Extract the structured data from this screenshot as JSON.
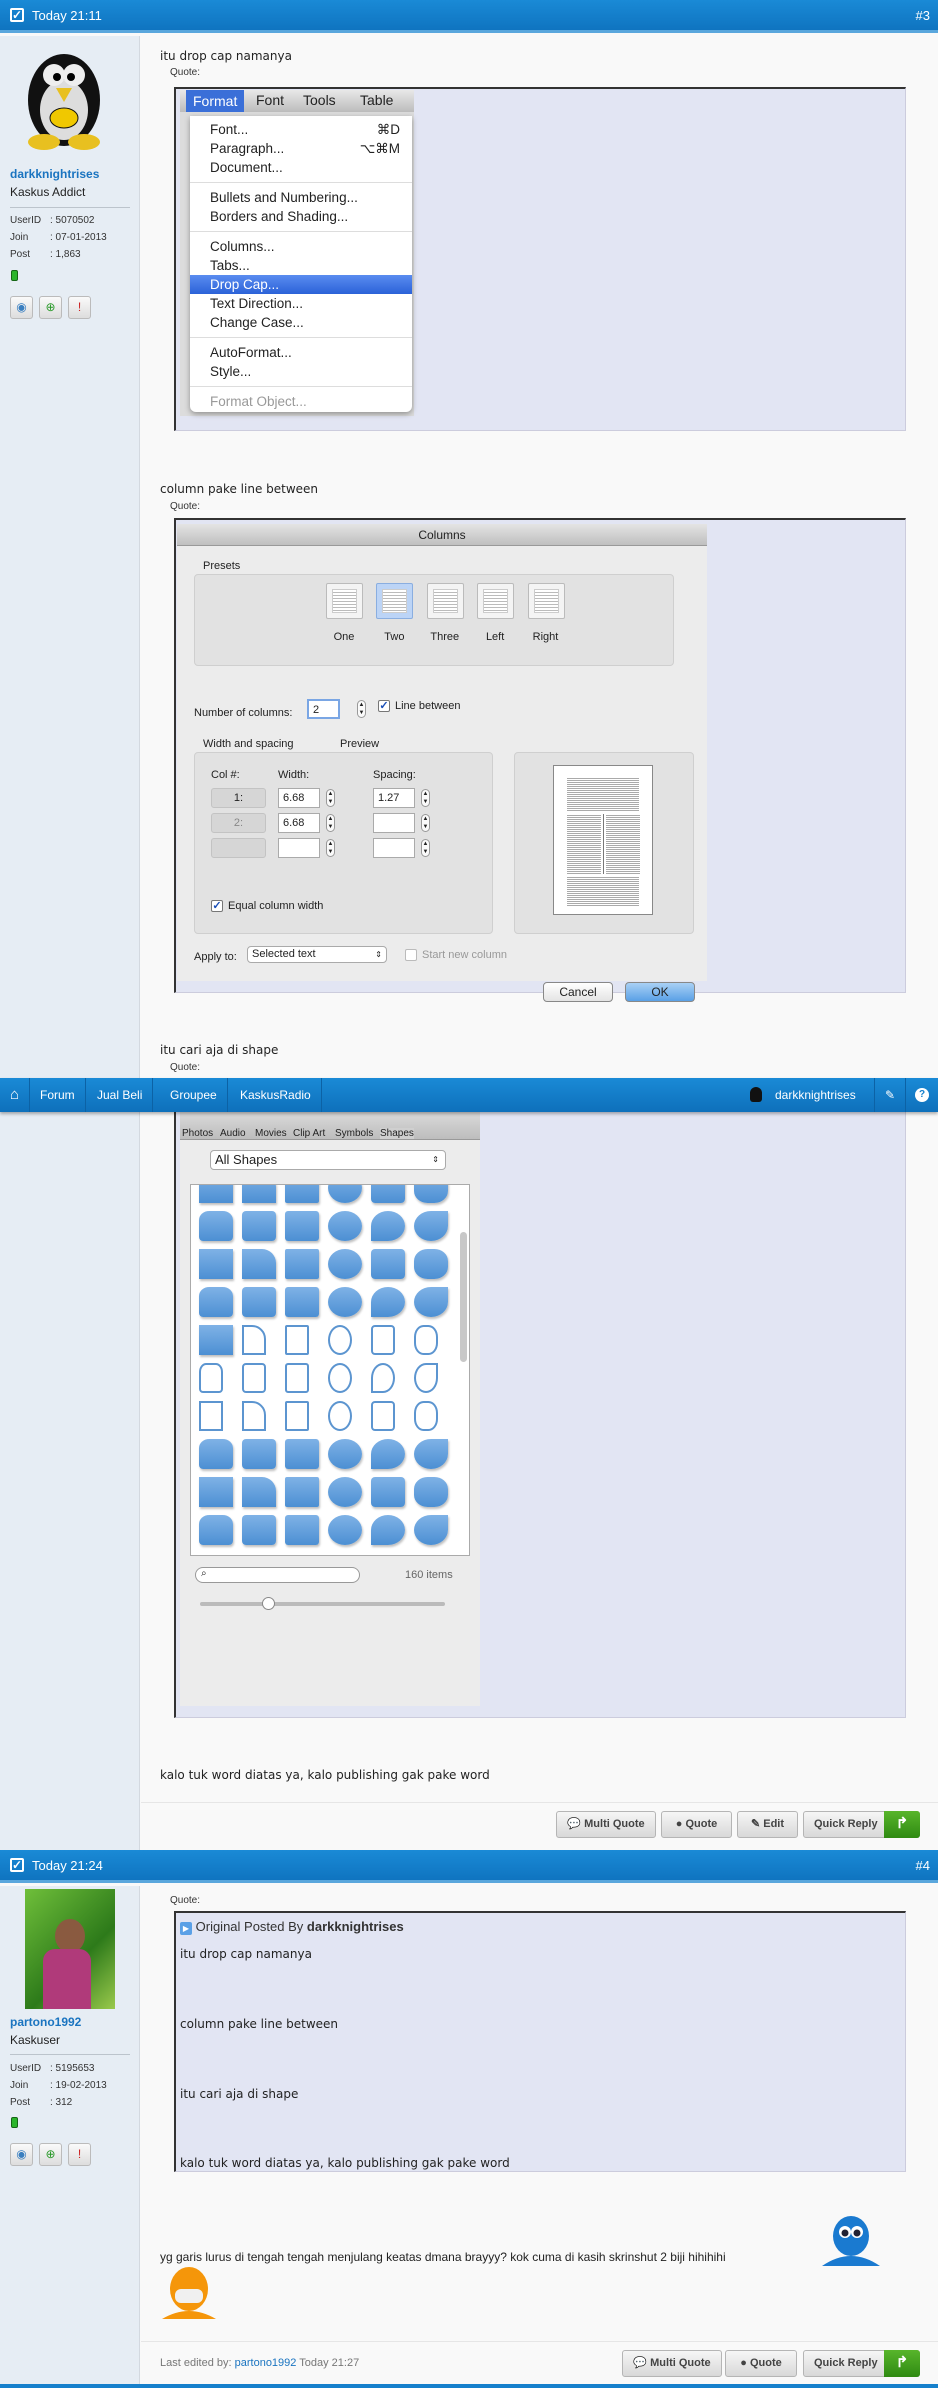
{
  "nav": {
    "items": [
      "Forum",
      "Jual Beli",
      "Groupee",
      "KaskusRadio"
    ],
    "user": "darkknightrises"
  },
  "posts": [
    {
      "time": "Today 21:11",
      "number": "#3",
      "username": "darkknightrises",
      "rank": "Kaskus Addict",
      "stats": [
        {
          "label": "UserID",
          "value": ": 5070502"
        },
        {
          "label": "Join",
          "value": ": 07-01-2013"
        },
        {
          "label": "Post",
          "value": ": 1,863"
        }
      ],
      "texts": [
        "itu drop cap namanya",
        "column pake line between",
        "itu cari aja di shape",
        "kalo tuk word diatas ya, kalo publishing gak pake word"
      ],
      "quote_label": "Quote:",
      "buttons": {
        "multi_quote": "Multi Quote",
        "quote": "Quote",
        "edit": "Edit",
        "quick_reply": "Quick Reply"
      }
    },
    {
      "time": "Today 21:24",
      "number": "#4",
      "username": "partono1992",
      "rank": "Kaskuser",
      "stats": [
        {
          "label": "UserID",
          "value": ": 5195653"
        },
        {
          "label": "Join",
          "value": ": 19-02-2013"
        },
        {
          "label": "Post",
          "value": ": 312"
        }
      ],
      "quote_label": "Quote:",
      "quote": {
        "prefix": "Original Posted By",
        "author": "darkknightrises",
        "lines": [
          "itu drop cap namanya",
          "column pake line between",
          "itu cari aja di shape",
          "kalo tuk word diatas ya, kalo publishing gak pake word"
        ]
      },
      "message": "yg garis lurus di tengah tengah menjulang keatas dmana brayyy? kok cuma di kasih skrinshut 2 biji hihihihi",
      "edited": {
        "prefix": "Last edited by:",
        "user": "partono1992",
        "time": "Today 21:27"
      },
      "buttons": {
        "multi_quote": "Multi Quote",
        "quote": "Quote",
        "quick_reply": "Quick Reply"
      }
    }
  ],
  "format_menu": {
    "bar": [
      "Format",
      "Font",
      "Tools",
      "Table"
    ],
    "items": [
      {
        "label": "Font...",
        "shortcut": "⌘D"
      },
      {
        "label": "Paragraph...",
        "shortcut": "⌥⌘M"
      },
      {
        "label": "Document..."
      },
      {
        "label": "Bullets and Numbering..."
      },
      {
        "label": "Borders and Shading..."
      },
      {
        "label": "Columns..."
      },
      {
        "label": "Tabs..."
      },
      {
        "label": "Drop Cap..."
      },
      {
        "label": "Text Direction..."
      },
      {
        "label": "Change Case..."
      },
      {
        "label": "AutoFormat..."
      },
      {
        "label": "Style..."
      },
      {
        "label": "Format Object..."
      }
    ]
  },
  "columns_dialog": {
    "title": "Columns",
    "presets_label": "Presets",
    "presets": [
      "One",
      "Two",
      "Three",
      "Left",
      "Right"
    ],
    "selected_preset": "Two",
    "num_label": "Number of columns:",
    "num_value": "2",
    "line_between": "Line between",
    "line_between_checked": true,
    "ws_label": "Width and spacing",
    "col_hdr": "Col #:",
    "width_hdr": "Width:",
    "spacing_hdr": "Spacing:",
    "rows": [
      {
        "col": "1:",
        "width": "6.68 cm",
        "spacing": "1.27 cm"
      },
      {
        "col": "2:",
        "width": "6.68 cm",
        "spacing": ""
      },
      {
        "col": "",
        "width": "",
        "spacing": ""
      }
    ],
    "equal": "Equal column width",
    "equal_checked": true,
    "preview_label": "Preview",
    "apply_label": "Apply to:",
    "apply_value": "Selected text",
    "start_new": "Start new column",
    "start_new_checked": false,
    "cancel": "Cancel",
    "ok": "OK"
  },
  "shapes_panel": {
    "tabs": [
      "Photos",
      "Audio",
      "Movies",
      "Clip Art",
      "Symbols",
      "Shapes"
    ],
    "active_tab": "Shapes",
    "category": "All Shapes",
    "count": "160 items"
  },
  "colors": {
    "header": "#1580cc",
    "link": "#1a74c0",
    "quote_bg": "#e2e5f3",
    "reply_green": "#3f9a1c"
  }
}
